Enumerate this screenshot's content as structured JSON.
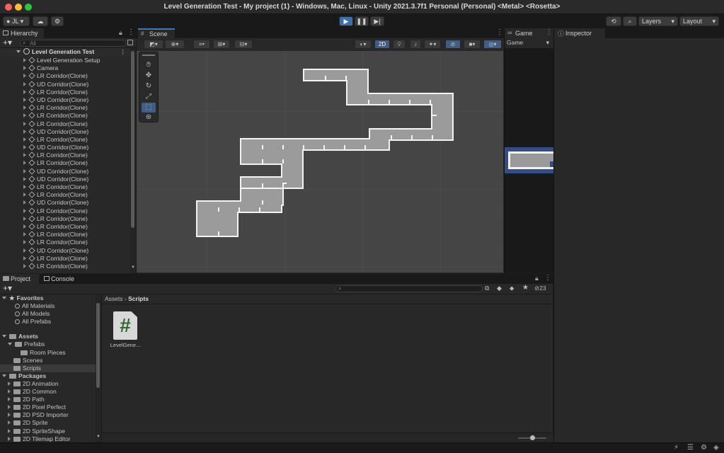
{
  "window": {
    "title": "Level Generation Test - My project (1) - Windows, Mac, Linux - Unity 2021.3.7f1 Personal (Personal) <Metal> <Rosetta>"
  },
  "toolbar": {
    "account": "JL",
    "layers": "Layers",
    "layout": "Layout"
  },
  "hierarchy": {
    "tab": "Hierarchy",
    "search_placeholder": "All",
    "root": "Level Generation Test",
    "items": [
      "Level Generation Setup",
      "Camera",
      "LR Corridor(Clone)",
      "UD Corridor(Clone)",
      "LR Corridor(Clone)",
      "UD Corridor(Clone)",
      "LR Corridor(Clone)",
      "LR Corridor(Clone)",
      "LR Corridor(Clone)",
      "UD Corridor(Clone)",
      "LR Corridor(Clone)",
      "UD Corridor(Clone)",
      "LR Corridor(Clone)",
      "LR Corridor(Clone)",
      "UD Corridor(Clone)",
      "UD Corridor(Clone)",
      "LR Corridor(Clone)",
      "LR Corridor(Clone)",
      "UD Corridor(Clone)",
      "LR Corridor(Clone)",
      "LR Corridor(Clone)",
      "LR Corridor(Clone)",
      "LR Corridor(Clone)",
      "LR Corridor(Clone)",
      "UD Corridor(Clone)",
      "LR Corridor(Clone)",
      "LR Corridor(Clone)"
    ]
  },
  "scene": {
    "tab": "Scene",
    "mode_2d": "2D"
  },
  "game": {
    "tab": "Game",
    "display": "Game"
  },
  "inspector": {
    "tab": "Inspector"
  },
  "project": {
    "tab": "Project",
    "console_tab": "Console",
    "hidden_count": "23",
    "breadcrumb_root": "Assets",
    "breadcrumb_sep": "›",
    "breadcrumb_current": "Scripts",
    "favorites_label": "Favorites",
    "favorites": [
      "All Materials",
      "All Models",
      "All Prefabs"
    ],
    "assets_label": "Assets",
    "prefabs_label": "Prefabs",
    "room_pieces_label": "Room Pieces",
    "scenes_label": "Scenes",
    "scripts_label": "Scripts",
    "packages_label": "Packages",
    "packages": [
      "2D Animation",
      "2D Common",
      "2D Path",
      "2D Pixel Perfect",
      "2D PSD Importer",
      "2D Sprite",
      "2D SpriteShape",
      "2D Tilemap Editor"
    ],
    "file_name": "LevelGene...",
    "file_icon_glyph": "#"
  },
  "colors": {
    "accent_blue": "#3a5a8c",
    "script_green": "#2f6b2f",
    "selection": "#2c5d87"
  }
}
